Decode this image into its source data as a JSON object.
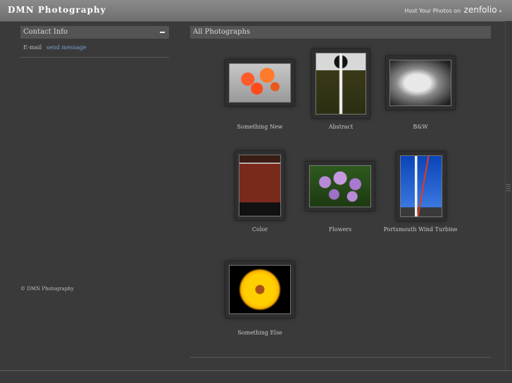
{
  "header": {
    "site_title": "DMN Photography",
    "host_text": "Host Your Photos on",
    "host_brand": "zenfolio",
    "host_arrow": "»"
  },
  "sidebar": {
    "contact_heading": "Contact Info",
    "contact_label": "E-mail",
    "contact_link": "send message",
    "copyright": "© DMN Photography"
  },
  "main": {
    "heading": "All Photographs",
    "galleries": [
      {
        "title": "Something New"
      },
      {
        "title": "Abstract"
      },
      {
        "title": "B&W"
      },
      {
        "title": "Color"
      },
      {
        "title": "Flowers"
      },
      {
        "title": "Portsmouth Wind Turbine"
      },
      {
        "title": "Something Else"
      }
    ]
  }
}
